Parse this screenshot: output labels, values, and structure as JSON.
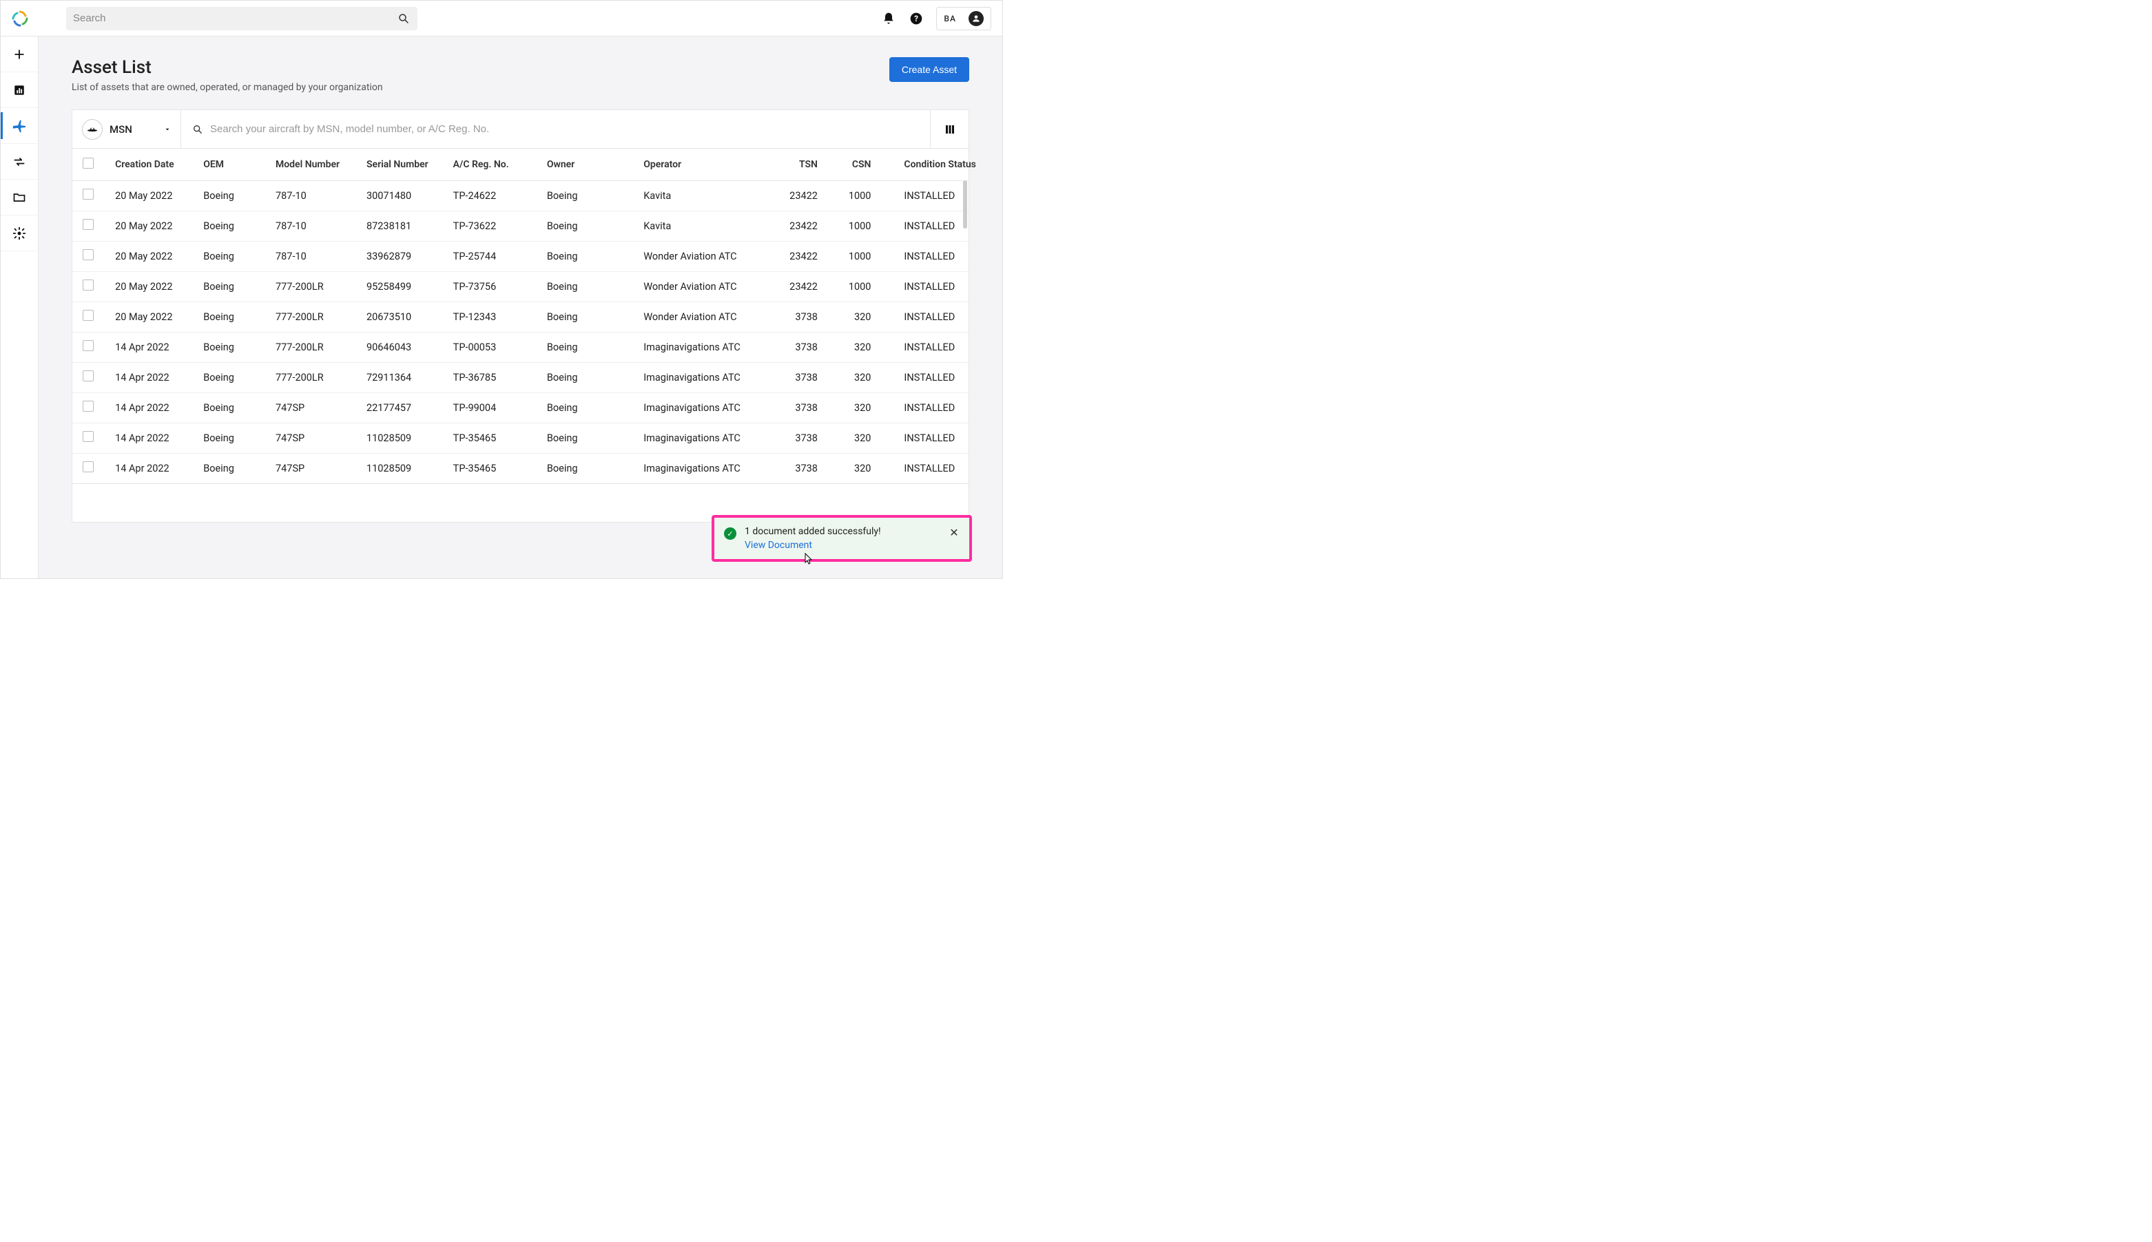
{
  "header": {
    "search_placeholder": "Search",
    "user_initials": "BA"
  },
  "page": {
    "title": "Asset List",
    "subtitle": "List of assets that are owned, operated, or managed by your organization",
    "create_button": "Create Asset"
  },
  "toolbar": {
    "filter_label": "MSN",
    "search_placeholder": "Search your aircraft by MSN, model number, or A/C Reg. No."
  },
  "columns": {
    "creation_date": "Creation Date",
    "oem": "OEM",
    "model": "Model Number",
    "serial": "Serial Number",
    "reg": "A/C Reg. No.",
    "owner": "Owner",
    "operator": "Operator",
    "tsn": "TSN",
    "csn": "CSN",
    "condition": "Condition Status"
  },
  "rows": [
    {
      "date": "20 May 2022",
      "oem": "Boeing",
      "model": "787-10",
      "serial": "30071480",
      "reg": "TP-24622",
      "owner": "Boeing",
      "operator": "Kavita",
      "tsn": "23422",
      "csn": "1000",
      "cond": "INSTALLED"
    },
    {
      "date": "20 May 2022",
      "oem": "Boeing",
      "model": "787-10",
      "serial": "87238181",
      "reg": "TP-73622",
      "owner": "Boeing",
      "operator": "Kavita",
      "tsn": "23422",
      "csn": "1000",
      "cond": "INSTALLED"
    },
    {
      "date": "20 May 2022",
      "oem": "Boeing",
      "model": "787-10",
      "serial": "33962879",
      "reg": "TP-25744",
      "owner": "Boeing",
      "operator": "Wonder Aviation ATC",
      "tsn": "23422",
      "csn": "1000",
      "cond": "INSTALLED"
    },
    {
      "date": "20 May 2022",
      "oem": "Boeing",
      "model": "777-200LR",
      "serial": "95258499",
      "reg": "TP-73756",
      "owner": "Boeing",
      "operator": "Wonder Aviation ATC",
      "tsn": "23422",
      "csn": "1000",
      "cond": "INSTALLED"
    },
    {
      "date": "20 May 2022",
      "oem": "Boeing",
      "model": "777-200LR",
      "serial": "20673510",
      "reg": "TP-12343",
      "owner": "Boeing",
      "operator": "Wonder Aviation ATC",
      "tsn": "3738",
      "csn": "320",
      "cond": "INSTALLED"
    },
    {
      "date": "14 Apr 2022",
      "oem": "Boeing",
      "model": "777-200LR",
      "serial": "90646043",
      "reg": "TP-00053",
      "owner": "Boeing",
      "operator": "Imaginavigations ATC",
      "tsn": "3738",
      "csn": "320",
      "cond": "INSTALLED"
    },
    {
      "date": "14 Apr 2022",
      "oem": "Boeing",
      "model": "777-200LR",
      "serial": "72911364",
      "reg": "TP-36785",
      "owner": "Boeing",
      "operator": "Imaginavigations ATC",
      "tsn": "3738",
      "csn": "320",
      "cond": "INSTALLED"
    },
    {
      "date": "14 Apr 2022",
      "oem": "Boeing",
      "model": "747SP",
      "serial": "22177457",
      "reg": "TP-99004",
      "owner": "Boeing",
      "operator": "Imaginavigations ATC",
      "tsn": "3738",
      "csn": "320",
      "cond": "INSTALLED"
    },
    {
      "date": "14 Apr 2022",
      "oem": "Boeing",
      "model": "747SP",
      "serial": "11028509",
      "reg": "TP-35465",
      "owner": "Boeing",
      "operator": "Imaginavigations ATC",
      "tsn": "3738",
      "csn": "320",
      "cond": "INSTALLED"
    },
    {
      "date": "14 Apr 2022",
      "oem": "Boeing",
      "model": "747SP",
      "serial": "11028509",
      "reg": "TP-35465",
      "owner": "Boeing",
      "operator": "Imaginavigations ATC",
      "tsn": "3738",
      "csn": "320",
      "cond": "INSTALLED"
    }
  ],
  "toast": {
    "message": "1 document added successfuly!",
    "link": "View Document"
  }
}
